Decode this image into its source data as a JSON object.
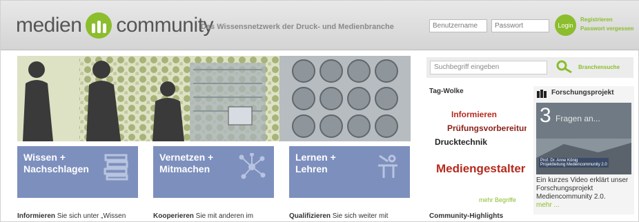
{
  "header": {
    "logo_left": "medien",
    "logo_right": "community",
    "tagline": "Das Wissensnetzwerk der Druck- und Medienbranche",
    "username_placeholder": "Benutzername",
    "password_placeholder": "Passwort",
    "login_label": "Login",
    "register_link": "Registrieren",
    "forgot_link": "Passwort vergessen"
  },
  "sections": [
    {
      "title": "Wissen +\nNachschlagen",
      "intro_bold": "Informieren",
      "intro_text": " Sie sich unter „Wissen"
    },
    {
      "title": "Vernetzen +\nMitmachen",
      "intro_bold": "Kooperieren",
      "intro_text": " Sie mit anderen im"
    },
    {
      "title": "Lernen +\nLehren",
      "intro_bold": "Qualifizieren",
      "intro_text": " Sie sich weiter mit"
    }
  ],
  "sidebar": {
    "search_placeholder": "Suchbegriff eingeben",
    "search_link": "Branchensuche",
    "tag_cloud_title": "Tag-Wolke",
    "tags": [
      "Informieren",
      "Prüfungsvorbereitung",
      "Drucktechnik",
      "Mediengestalter"
    ],
    "tag_cloud_more": "mehr Begriffe",
    "community_title": "Community-Highlights",
    "research_title": "Forschungsprojekt",
    "video_number": "3",
    "video_caption": "Fragen an...",
    "video_credit": "Prof. Dr. Anne König",
    "video_credit2": "Projektleitung Mediencommunity 2.0",
    "research_text": "Ein kurzes Video erklärt unser Forschungsprojekt Mediencommunity 2.0.",
    "research_more": "mehr ..."
  },
  "colors": {
    "accent_green": "#8bbd2d",
    "nav_blue": "#7d8fbd",
    "tag_red": "#b52a1e"
  }
}
